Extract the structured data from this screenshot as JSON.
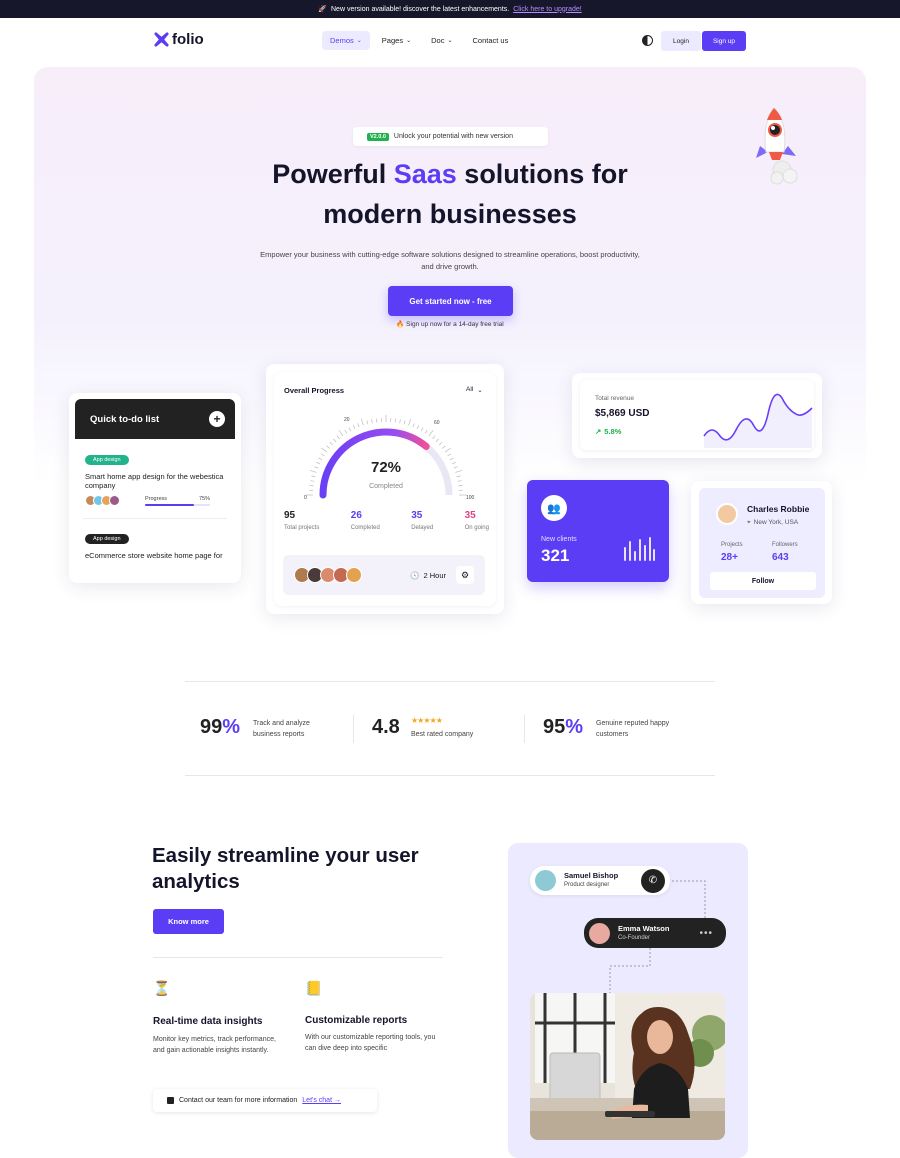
{
  "announcement": {
    "text": "New version available! discover the latest enhancements.",
    "link": "Click here to upgrade!"
  },
  "nav": {
    "logo": "folio",
    "items": [
      "Demos",
      "Pages",
      "Doc",
      "Contact us"
    ],
    "login": "Login",
    "signup": "Sign up"
  },
  "hero": {
    "badge_version": "V2.0.0",
    "badge_text": "Unlock your potential with new version",
    "title_part1": "Powerful",
    "title_accent": "Saas",
    "title_part2": "solutions for",
    "title_line2": "modern businesses",
    "subtitle": "Empower your business with cutting-edge software solutions designed to streamline operations, boost productivity, and drive growth.",
    "cta": "Get started now - free",
    "trial": "Sign up now for a 14-day free trial"
  },
  "todo": {
    "title": "Quick to-do list",
    "task1_tag": "App design",
    "task1_text": "Smart home app design for the webestica company",
    "task1_progress_label": "Progress",
    "task1_progress_value": "75%",
    "task1_progress_fraction": 0.75,
    "task2_tag": "App design",
    "task2_text": "eCommerce store website home page for blogzine"
  },
  "progress": {
    "title": "Overall Progress",
    "filter": "All",
    "percent": "72%",
    "percent_value": 0.72,
    "percent_label": "Completed",
    "scale_min": "0",
    "scale_mid1": "20",
    "scale_mid2": "60",
    "scale_max": "100",
    "stats": [
      {
        "value": "95",
        "label": "Total projects",
        "color": "#222222"
      },
      {
        "value": "26",
        "label": "Completed",
        "color": "#5b3df5"
      },
      {
        "value": "35",
        "label": "Delayed",
        "color": "#5b3df5"
      },
      {
        "value": "35",
        "label": "On going",
        "color": "#e0408a"
      }
    ],
    "time": "2 Hour"
  },
  "revenue": {
    "label": "Total revenue",
    "value": "$5,869 USD",
    "change": "5.8%"
  },
  "clients": {
    "label": "New clients",
    "value": "321"
  },
  "profile": {
    "name": "Charles Robbie",
    "location": "New York, USA",
    "projects_label": "Projects",
    "projects_value": "28+",
    "followers_label": "Followers",
    "followers_value": "643",
    "follow": "Follow"
  },
  "stats": [
    {
      "value": "99",
      "suffix": "%",
      "desc": "Track and analyze business reports"
    },
    {
      "value": "4.8",
      "suffix": "",
      "desc": "Best rated company",
      "rating": "★★★★★"
    },
    {
      "value": "95",
      "suffix": "%",
      "desc": "Genuine reputed happy customers"
    }
  ],
  "feature": {
    "title": "Easily streamline your user analytics",
    "button": "Know more",
    "item1_title": "Real-time data insights",
    "item1_text": "Monitor key metrics, track performance, and gain actionable insights instantly.",
    "item2_title": "Customizable reports",
    "item2_text": "With our customizable reporting tools, you can dive deep into specific",
    "contact_text": "Contact our team for more information",
    "contact_link": "Let's chat →"
  },
  "chat": {
    "user1_name": "Samuel Bishop",
    "user1_role": "Product designer",
    "user2_name": "Emma Watson",
    "user2_role": "Co-Founder"
  },
  "colors": {
    "accent": "#5b3df5",
    "dark": "#14142b",
    "pink": "#e0408a",
    "green": "#22b14c"
  }
}
